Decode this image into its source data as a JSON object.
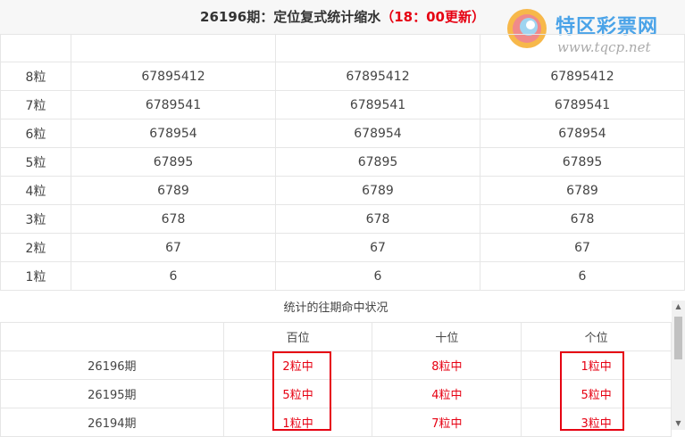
{
  "header": {
    "title_main": "26196期：定位复式统计缩水",
    "title_time": "（18：00更新）"
  },
  "logo": {
    "name": "特区彩票网",
    "url": "www.tqcp.net"
  },
  "grid": {
    "rows": [
      {
        "label": "8粒",
        "values": [
          "67895412",
          "67895412",
          "67895412"
        ]
      },
      {
        "label": "7粒",
        "values": [
          "6789541",
          "6789541",
          "6789541"
        ]
      },
      {
        "label": "6粒",
        "values": [
          "678954",
          "678954",
          "678954"
        ]
      },
      {
        "label": "5粒",
        "values": [
          "67895",
          "67895",
          "67895"
        ]
      },
      {
        "label": "4粒",
        "values": [
          "6789",
          "6789",
          "6789"
        ]
      },
      {
        "label": "3粒",
        "values": [
          "678",
          "678",
          "678"
        ]
      },
      {
        "label": "2粒",
        "values": [
          "67",
          "67",
          "67"
        ]
      },
      {
        "label": "1粒",
        "values": [
          "6",
          "6",
          "6"
        ]
      }
    ]
  },
  "history": {
    "title": "统计的往期命中状况",
    "headers": [
      "百位",
      "十位",
      "个位"
    ],
    "rows": [
      {
        "period": "26196期",
        "values": [
          "2粒中",
          "8粒中",
          "1粒中"
        ]
      },
      {
        "period": "26195期",
        "values": [
          "5粒中",
          "4粒中",
          "5粒中"
        ]
      },
      {
        "period": "26194期",
        "values": [
          "1粒中",
          "7粒中",
          "3粒中"
        ]
      }
    ]
  },
  "colors": {
    "accent": "#e60012",
    "logo_blue": "#4aa3e8"
  },
  "icons": {
    "logo": "swirl-logo-icon",
    "scroll_up": "chevron-up-icon",
    "scroll_down": "chevron-down-icon"
  }
}
